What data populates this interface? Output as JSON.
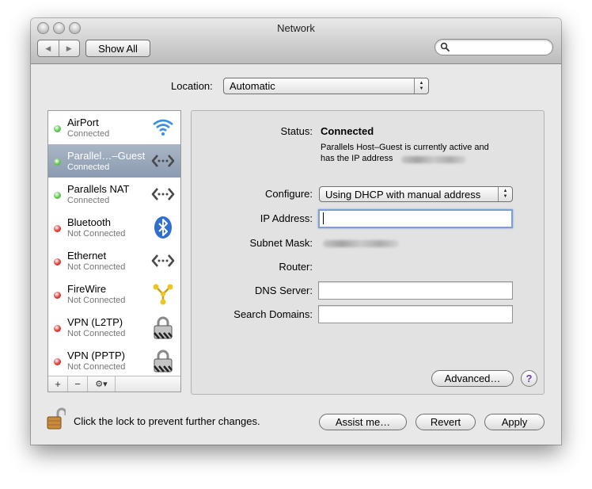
{
  "window": {
    "title": "Network"
  },
  "toolbar": {
    "back_glyph": "◀",
    "forward_glyph": "▶",
    "show_all_label": "Show All",
    "search_placeholder": ""
  },
  "location": {
    "label": "Location:",
    "value": "Automatic"
  },
  "services": [
    {
      "name": "AirPort",
      "status": "Connected",
      "status_color": "#5cc24a",
      "icon": "wifi-icon",
      "selected": false
    },
    {
      "name": "Parallel…–Guest",
      "status": "Connected",
      "status_color": "#5cc24a",
      "icon": "ethernet-icon",
      "selected": true
    },
    {
      "name": "Parallels NAT",
      "status": "Connected",
      "status_color": "#5cc24a",
      "icon": "ethernet-icon",
      "selected": false
    },
    {
      "name": "Bluetooth",
      "status": "Not Connected",
      "status_color": "#d63a32",
      "icon": "bluetooth-icon",
      "selected": false
    },
    {
      "name": "Ethernet",
      "status": "Not Connected",
      "status_color": "#d63a32",
      "icon": "ethernet-icon",
      "selected": false
    },
    {
      "name": "FireWire",
      "status": "Not Connected",
      "status_color": "#d63a32",
      "icon": "firewire-icon",
      "selected": false
    },
    {
      "name": "VPN (L2TP)",
      "status": "Not Connected",
      "status_color": "#d63a32",
      "icon": "vpn-lock-icon",
      "selected": false
    },
    {
      "name": "VPN (PPTP)",
      "status": "Not Connected",
      "status_color": "#d63a32",
      "icon": "vpn-lock-icon",
      "selected": false
    }
  ],
  "sidebar_tools": {
    "add": "+",
    "remove": "−",
    "action": "⚙▾"
  },
  "details": {
    "status_label": "Status:",
    "status_value": "Connected",
    "status_desc_line1": "Parallels Host–Guest is currently active and",
    "status_desc_line2": "has the IP address",
    "configure_label": "Configure:",
    "configure_value": "Using DHCP with manual address",
    "ip_label": "IP Address:",
    "ip_value": "",
    "subnet_label": "Subnet Mask:",
    "router_label": "Router:",
    "dns_label": "DNS Server:",
    "dns_value": "",
    "search_domains_label": "Search Domains:",
    "search_domains_value": "",
    "advanced_label": "Advanced…",
    "help_label": "?"
  },
  "footer": {
    "lock_text": "Click the lock to prevent further changes.",
    "assist_label": "Assist me…",
    "revert_label": "Revert",
    "apply_label": "Apply"
  }
}
